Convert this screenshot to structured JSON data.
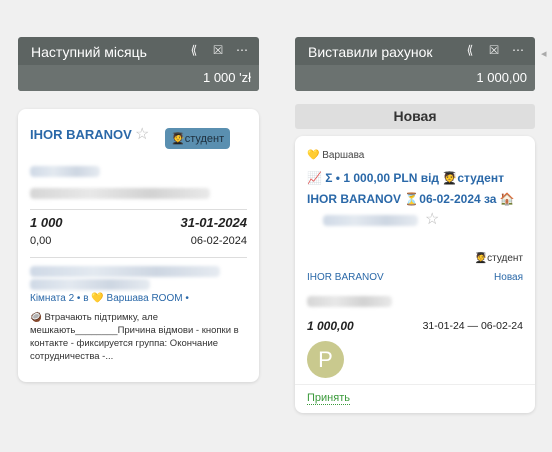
{
  "columns": [
    {
      "title": "Наступний місяць",
      "total": "1 000 'zł",
      "card": {
        "client_name": "IHOR BARANOV",
        "badge": "🧑‍🎓студент",
        "amount": "1 000",
        "date1": "31-01-2024",
        "paid": "0,00",
        "date2": "06-02-2024",
        "location": "Кімната 2 • в 💛 Варшава ROOM •",
        "note": "🥥 Втрачають підтримку, але мешкають________Причина відмови - кнопки в контакте - фиксируется группа: Окончание сотрудничества -..."
      }
    },
    {
      "title": "Виставили рахунок",
      "total": "1 000,00",
      "status_label": "Новая",
      "card": {
        "city": "💛 Варшава",
        "headline": "📈 Σ • 1 000,00 PLN від 🧑‍🎓студент IHOR BARANOV ⏳06-02-2024 за 🏠",
        "tag": "🧑‍🎓студент",
        "client_name": "IHOR BARANOV",
        "status": "Новая",
        "amount": "1 000,00",
        "date_range": "31-01-24 — 06-02-24",
        "avatar_letter": "P",
        "accept_label": "Принять"
      }
    }
  ],
  "icons": [
    "collapse-icon",
    "scan-icon",
    "more-icon"
  ],
  "colors": {
    "header_bg": "#5d6462",
    "link": "#2a68a8",
    "badge": "#5a8fb0",
    "avatar": "#c9c98e",
    "accept": "#3a9a3a"
  }
}
